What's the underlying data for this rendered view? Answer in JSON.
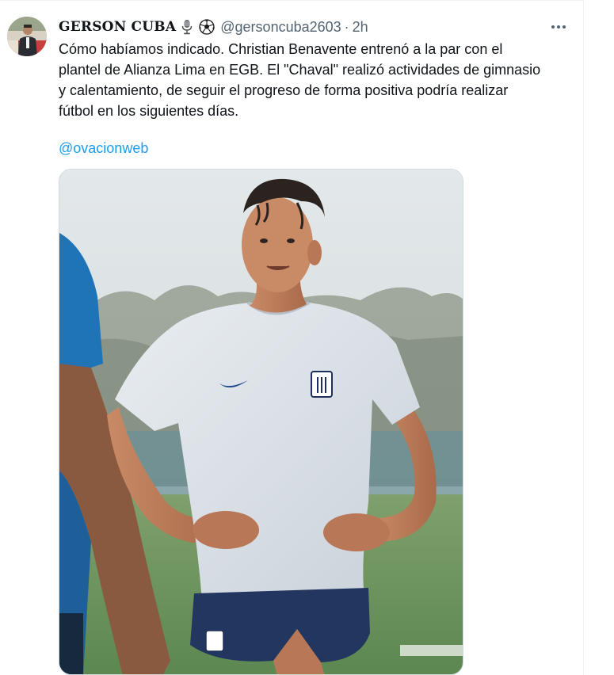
{
  "tweet": {
    "display_name": "GERSON CUBA",
    "emojis": [
      "studio-microphone-icon",
      "soccer-ball-icon"
    ],
    "handle": "@gersoncuba2603",
    "separator": "·",
    "time": "2h",
    "text": "Cómo habíamos indicado. Christian Benavente entrenó a la par con el\nplantel de Alianza Lima en EGB. El \"Chaval\" realizó actividades de gimnasio\ny calentamiento, de seguir el progreso de forma positiva podría realizar\nfútbol en los siguientes días.",
    "mention": "@ovacionweb"
  },
  "colors": {
    "text": "#0f1419",
    "secondary": "#536471",
    "link": "#1d9bf0",
    "border": "#eff3f4"
  },
  "icons": {
    "more": "more-horizontal-icon"
  }
}
